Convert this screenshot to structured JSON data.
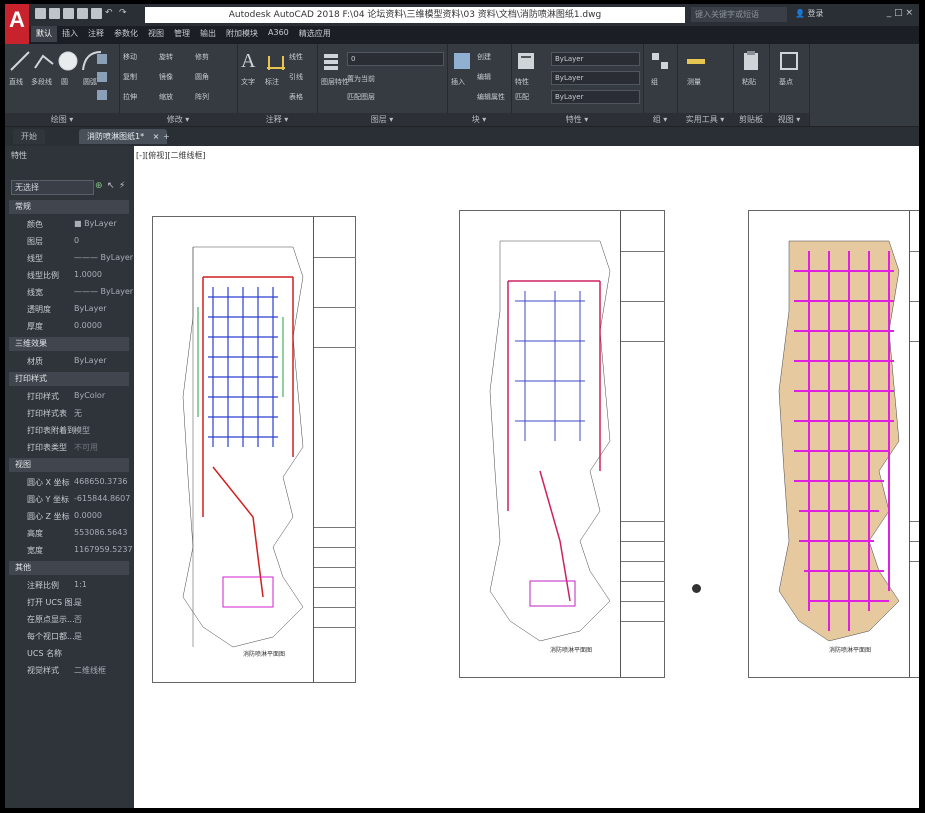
{
  "app": {
    "logo": "A",
    "title": "Autodesk AutoCAD 2018    F:\\04 论坛资料\\三维模型资料\\03 资料\\文档\\消防喷淋图纸1.dwg",
    "search_placeholder": "键入关键字或短语",
    "login": "登录",
    "window_controls": "_ □ ×"
  },
  "ribbon": {
    "tabs": [
      "默认",
      "插入",
      "注释",
      "参数化",
      "视图",
      "管理",
      "输出",
      "附加模块",
      "A360",
      "精选应用"
    ],
    "active_tab": "默认",
    "panels": {
      "draw": {
        "label": "绘图 ▾",
        "buttons": [
          "直线",
          "多段线",
          "圆",
          "圆弧"
        ]
      },
      "modify": {
        "label": "修改 ▾",
        "items": [
          "移动",
          "旋转",
          "修剪",
          "复制",
          "镜像",
          "圆角",
          "拉伸",
          "缩放",
          "阵列"
        ]
      },
      "annotation": {
        "label": "注释 ▾",
        "buttons": [
          "文字",
          "标注"
        ],
        "items": [
          "线性",
          "引线",
          "表格"
        ]
      },
      "layers": {
        "label": "图层 ▾",
        "layer_value": "0",
        "items": [
          "图层特性",
          "置为当前",
          "匹配图层"
        ]
      },
      "block": {
        "label": "块 ▾",
        "items": [
          "插入",
          "创建",
          "编辑",
          "编辑属性"
        ]
      },
      "properties": {
        "label": "特性 ▾",
        "bylayer_color": "ByLayer",
        "bylayer_linetype": "ByLayer",
        "bylayer_lineweight": "ByLayer",
        "items": [
          "特性",
          "匹配"
        ]
      },
      "groups": {
        "label": "组 ▾",
        "items": [
          "组"
        ]
      },
      "utilities": {
        "label": "实用工具 ▾",
        "items": [
          "测量"
        ]
      },
      "clipboard": {
        "label": "剪贴板",
        "items": [
          "粘贴"
        ]
      },
      "view": {
        "label": "视图 ▾",
        "items": [
          "基点"
        ]
      }
    }
  },
  "doc_tabs": [
    {
      "label": "开始",
      "active": false
    },
    {
      "label": "消防喷淋图纸1*",
      "active": true
    }
  ],
  "properties_palette": {
    "title": "特性",
    "selection": "无选择",
    "sections": [
      {
        "name": "常规",
        "rows": [
          {
            "k": "颜色",
            "v": "■ ByLayer"
          },
          {
            "k": "图层",
            "v": "0"
          },
          {
            "k": "线型",
            "v": "——— ByLayer"
          },
          {
            "k": "线型比例",
            "v": "1.0000"
          },
          {
            "k": "线宽",
            "v": "——— ByLayer"
          },
          {
            "k": "透明度",
            "v": "ByLayer"
          },
          {
            "k": "厚度",
            "v": "0.0000"
          }
        ]
      },
      {
        "name": "三维效果",
        "rows": [
          {
            "k": "材质",
            "v": "ByLayer"
          }
        ]
      },
      {
        "name": "打印样式",
        "rows": [
          {
            "k": "打印样式",
            "v": "ByColor"
          },
          {
            "k": "打印样式表",
            "v": "无"
          },
          {
            "k": "打印表附着到",
            "v": "模型"
          },
          {
            "k": "打印表类型",
            "v": "不可用"
          }
        ]
      },
      {
        "name": "视图",
        "rows": [
          {
            "k": "圆心 X 坐标",
            "v": "468650.3736"
          },
          {
            "k": "圆心 Y 坐标",
            "v": "-615844.8607"
          },
          {
            "k": "圆心 Z 坐标",
            "v": "0.0000"
          },
          {
            "k": "高度",
            "v": "553086.5643"
          },
          {
            "k": "宽度",
            "v": "1167959.5237"
          }
        ]
      },
      {
        "name": "其他",
        "rows": [
          {
            "k": "注释比例",
            "v": "1:1"
          },
          {
            "k": "打开 UCS 图...",
            "v": "是"
          },
          {
            "k": "在原点显示...",
            "v": "否"
          },
          {
            "k": "每个视口都...",
            "v": "是"
          },
          {
            "k": "UCS 名称",
            "v": ""
          },
          {
            "k": "视觉样式",
            "v": "二维线框"
          }
        ]
      }
    ]
  },
  "viewport": {
    "label": "[-][俯视][二维线框]"
  },
  "sheets": [
    {
      "name": "sheet-1",
      "caption": "消防喷淋平面图",
      "theme": "blue"
    },
    {
      "name": "sheet-2",
      "caption": "消防喷淋平面图",
      "theme": "purple"
    },
    {
      "name": "sheet-3",
      "caption": "消防喷淋平面图",
      "theme": "magenta"
    }
  ],
  "colors": {
    "accent": "#c8232c",
    "ribbon_bg": "#363a41",
    "canvas_bg": "#ffffff"
  }
}
